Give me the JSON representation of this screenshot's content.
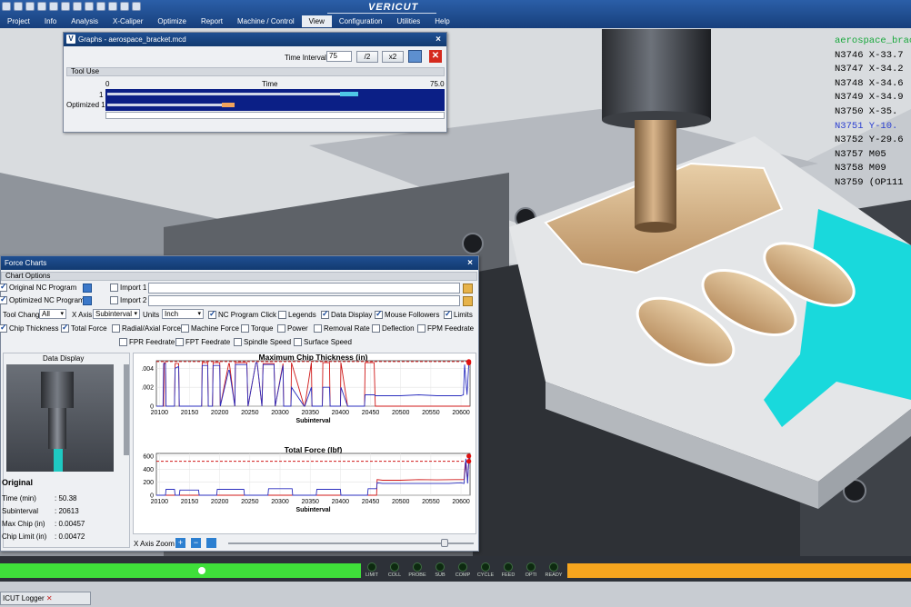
{
  "app": {
    "brand": "VERICUT"
  },
  "menu": [
    "Project",
    "Info",
    "Analysis",
    "X-Caliper",
    "Optimize",
    "Report",
    "Machine / Control",
    "View",
    "Configuration",
    "Utilities",
    "Help"
  ],
  "menu_active": "View",
  "nc_program": {
    "header": "aerospace_brac",
    "lines": [
      "N3746 X-33.7",
      "N3747 X-34.2",
      "N3748 X-34.6",
      "N3749 X-34.9",
      "N3750 X-35.",
      "N3751 Y-10.",
      "N3752 Y-29.6",
      "N3757 M05",
      "N3758 M09",
      "N3759 (OP111"
    ],
    "current_index": 5
  },
  "graphs_window": {
    "title": "Graphs - aerospace_bracket.mcd",
    "time_interval_label": "Time Interval",
    "time_interval_value": "75",
    "btn_half": "/2",
    "btn_double": "x2",
    "section": "Tool Use",
    "axis_start": "0",
    "axis_label": "Time",
    "axis_end": "75.0",
    "rows": [
      "1",
      "Optimized 1"
    ]
  },
  "force_window": {
    "title": "Force Charts",
    "section": "Chart Options",
    "programs": [
      {
        "label": "Original NC Program",
        "checked": true
      },
      {
        "label": "Optimized NC Program",
        "checked": true
      }
    ],
    "imports": [
      "Import 1",
      "Import 2"
    ],
    "tool_change_label": "Tool Change",
    "tool_change_value": "All",
    "x_axis_label": "X Axis",
    "x_axis_value": "Subinterval",
    "units_label": "Units",
    "units_value": "Inch",
    "options_row1": [
      {
        "label": "NC Program Click",
        "checked": true
      },
      {
        "label": "Legends",
        "checked": false
      },
      {
        "label": "Data Display",
        "checked": true
      },
      {
        "label": "Mouse Followers",
        "checked": true
      },
      {
        "label": "Limits",
        "checked": true
      }
    ],
    "options_row2": [
      {
        "label": "Chip Thickness",
        "checked": true
      },
      {
        "label": "Total Force",
        "checked": true
      },
      {
        "label": "Radial/Axial Force",
        "checked": false
      },
      {
        "label": "Machine Force",
        "checked": false
      },
      {
        "label": "Torque",
        "checked": false
      },
      {
        "label": "Power",
        "checked": false
      },
      {
        "label": "Removal Rate",
        "checked": false
      },
      {
        "label": "Deflection",
        "checked": false
      },
      {
        "label": "FPM Feedrate",
        "checked": false
      }
    ],
    "options_row3": [
      {
        "label": "FPR Feedrate",
        "checked": false
      },
      {
        "label": "FPT Feedrate",
        "checked": false
      },
      {
        "label": "Spindle Speed",
        "checked": false
      },
      {
        "label": "Surface Speed",
        "checked": false
      }
    ],
    "data_display_label": "Data Display",
    "data_display": {
      "heading": "Original",
      "rows": [
        {
          "k": "Time (min)",
          "v": ": 50.38"
        },
        {
          "k": "Subinterval",
          "v": ": 20613"
        },
        {
          "k": "Max Chip (in)",
          "v": ": 0.00457"
        },
        {
          "k": "Chip Limit (in)",
          "v": ": 0.00472"
        }
      ]
    },
    "x_axis_zoom_label": "X Axis Zoom"
  },
  "chart_data": [
    {
      "type": "line",
      "title": "Maximum Chip Thickness (in)",
      "xlabel": "Subinterval",
      "ylabel": "",
      "xlim": [
        20095,
        20615
      ],
      "ylim": [
        0,
        0.0048
      ],
      "xticks": [
        20100,
        20150,
        20200,
        20250,
        20300,
        20350,
        20400,
        20450,
        20500,
        20550,
        20600
      ],
      "yticks": [
        {
          "v": 0,
          "label": "0"
        },
        {
          "v": 0.002,
          "label": ".002"
        },
        {
          "v": 0.004,
          "label": ".004"
        }
      ],
      "limit": 0.00472,
      "series": [
        {
          "color": "#2b2fbf",
          "x": [
            20095,
            20106,
            20107,
            20110,
            20111,
            20125,
            20126,
            20132,
            20133,
            20170,
            20171,
            20180,
            20181,
            20188,
            20189,
            20200,
            20201,
            20215,
            20216,
            20225,
            20226,
            20245,
            20247,
            20260,
            20262,
            20270,
            20272,
            20290,
            20292,
            20305,
            20306,
            20318,
            20319,
            20340,
            20341,
            20352,
            20353,
            20370,
            20371,
            20382,
            20383,
            20400,
            20401,
            20412,
            20413,
            20440,
            20441,
            20456,
            20458,
            20470,
            20500,
            20530,
            20560,
            20590,
            20600,
            20604,
            20606,
            20610,
            20613,
            20615
          ],
          "y": [
            0,
            0,
            0.0045,
            0.0045,
            0,
            0,
            0.004,
            0.0042,
            0,
            0,
            0.0043,
            0.0043,
            0,
            0,
            0.0043,
            0.0043,
            0,
            0.0038,
            0.0038,
            0,
            0.0044,
            0.0044,
            0,
            0.0046,
            0.0046,
            0,
            0.0044,
            0.0044,
            0,
            0.0043,
            0,
            0,
            0.002,
            0,
            0,
            0.002,
            0,
            0,
            0.002,
            0.002,
            0,
            0,
            0.002,
            0,
            0,
            0,
            0.0012,
            0.0012,
            0.0011,
            0.0011,
            0.0011,
            0.0012,
            0.0011,
            0.0011,
            0.0011,
            0.0012,
            0.0044,
            0.0012,
            0.00457,
            0.00457
          ]
        },
        {
          "color": "#d01818",
          "x": [
            20095,
            20107,
            20108,
            20110,
            20111,
            20125,
            20126,
            20132,
            20133,
            20170,
            20171,
            20180,
            20181,
            20188,
            20189,
            20200,
            20201,
            20215,
            20216,
            20225,
            20226,
            20245,
            20247,
            20260,
            20262,
            20270,
            20272,
            20290,
            20292,
            20305,
            20306,
            20318,
            20319,
            20340,
            20341,
            20352,
            20353,
            20370,
            20371,
            20382,
            20383,
            20400,
            20401,
            20412,
            20413,
            20440,
            20441,
            20456,
            20458,
            20615
          ],
          "y": [
            0,
            0,
            0.0046,
            0.0046,
            0,
            0,
            0.0045,
            0.0045,
            0,
            0,
            0.0046,
            0.0046,
            0,
            0,
            0.0046,
            0.0046,
            0,
            0.0045,
            0.0045,
            0,
            0.0046,
            0.0046,
            0,
            0.0046,
            0.0046,
            0,
            0.0045,
            0.0045,
            0,
            0.0045,
            0,
            0,
            0.0046,
            0,
            0,
            0.0046,
            0,
            0,
            0.0046,
            0.0046,
            0,
            0,
            0.0046,
            0,
            0,
            0,
            0.0046,
            0.0046,
            0,
            0
          ]
        }
      ],
      "markers": [
        {
          "x": 20613,
          "y": 0.00457
        },
        {
          "x": 20613,
          "y": 0.00472
        }
      ]
    },
    {
      "type": "line",
      "title": "Total Force (lbf)",
      "xlabel": "Subinterval",
      "ylabel": "",
      "xlim": [
        20095,
        20615
      ],
      "ylim": [
        0,
        640
      ],
      "xticks": [
        20100,
        20150,
        20200,
        20250,
        20300,
        20350,
        20400,
        20450,
        20500,
        20550,
        20600
      ],
      "yticks": [
        {
          "v": 0,
          "label": "0"
        },
        {
          "v": 200,
          "label": "200"
        },
        {
          "v": 400,
          "label": "400"
        },
        {
          "v": 600,
          "label": "600"
        }
      ],
      "limit": 520,
      "series": [
        {
          "color": "#2b2fbf",
          "x": [
            20095,
            20110,
            20111,
            20125,
            20126,
            20133,
            20134,
            20165,
            20166,
            20195,
            20196,
            20240,
            20241,
            20280,
            20281,
            20320,
            20321,
            20360,
            20361,
            20400,
            20401,
            20445,
            20446,
            20460,
            20461,
            20470,
            20500,
            20540,
            20580,
            20600,
            20605,
            20608,
            20611,
            20613,
            20615
          ],
          "y": [
            0,
            0,
            90,
            90,
            0,
            0,
            80,
            80,
            0,
            0,
            90,
            90,
            0,
            0,
            100,
            100,
            0,
            0,
            90,
            90,
            0,
            0,
            100,
            100,
            190,
            180,
            180,
            180,
            180,
            190,
            180,
            560,
            180,
            560,
            560
          ]
        },
        {
          "color": "#d01818",
          "x": [
            20095,
            20460,
            20461,
            20470,
            20500,
            20530,
            20560,
            20590,
            20605,
            20607,
            20611,
            20613,
            20615
          ],
          "y": [
            0,
            0,
            240,
            230,
            230,
            240,
            235,
            240,
            240,
            500,
            240,
            520,
            520
          ]
        }
      ],
      "markers": [
        {
          "x": 20613,
          "y": 520
        },
        {
          "x": 20613,
          "y": 600
        }
      ]
    }
  ],
  "status": {
    "leds": [
      "LIMIT",
      "COLL",
      "PROBE",
      "SUB",
      "COMP",
      "CYCLE",
      "FEED",
      "OPTI",
      "READY"
    ],
    "progress": 0.4,
    "logger_label": "ICUT Logger"
  },
  "colors": {
    "menubar": "#1f4f92",
    "progress": "#3fe03a",
    "progress_rest": "#f6a51e",
    "stock": "#c9a47a",
    "toolpath": "#19d9dc"
  }
}
